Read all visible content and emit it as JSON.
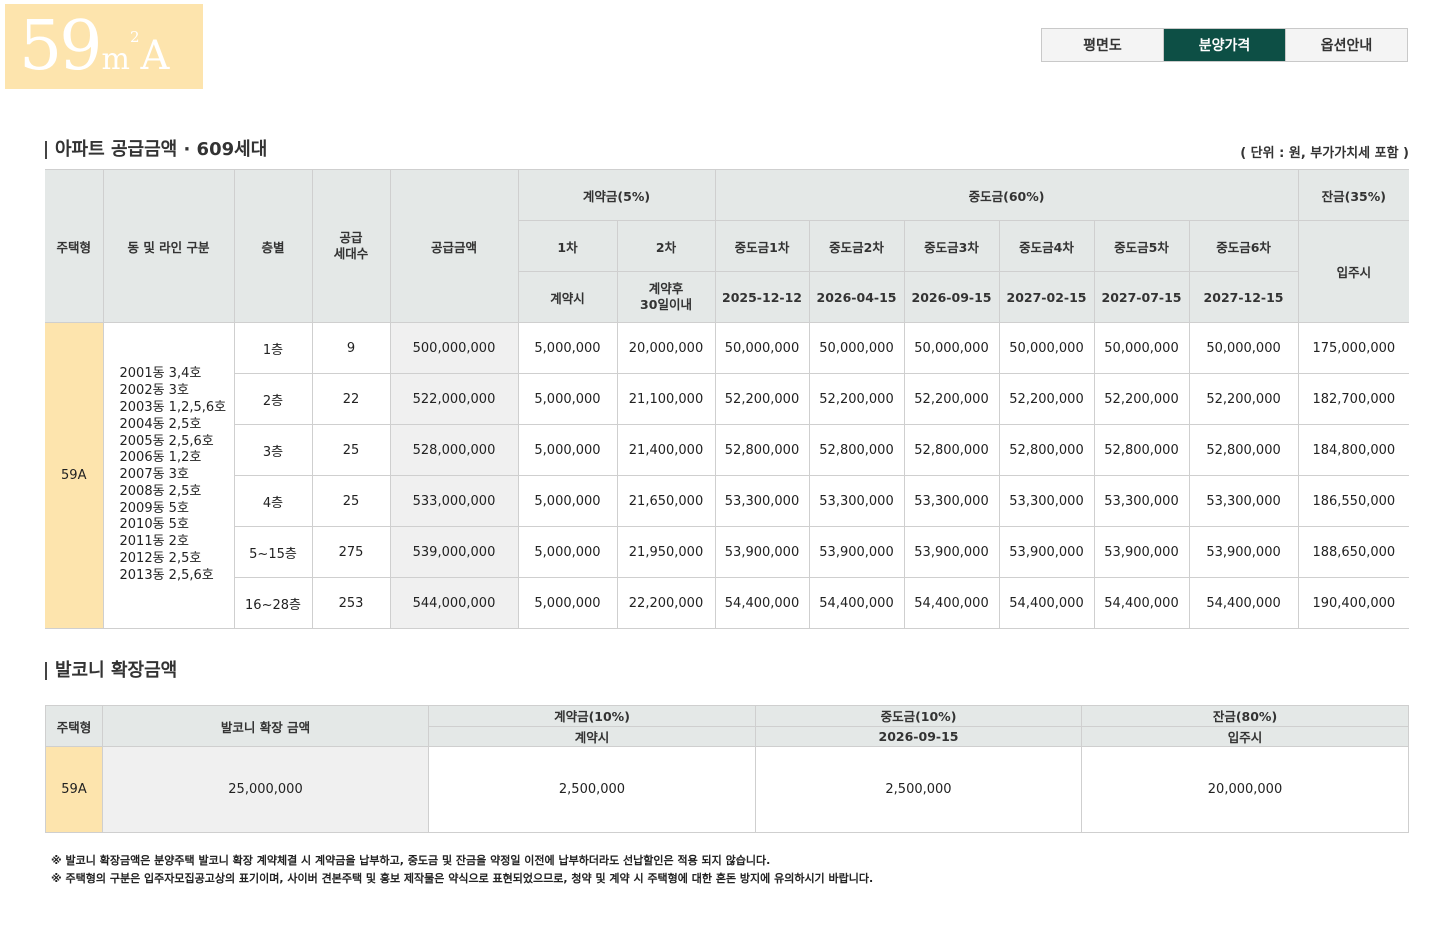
{
  "badge": {
    "number": "59",
    "unit": "m",
    "sup": "2",
    "letter": "A"
  },
  "tabs": [
    {
      "label": "평면도",
      "active": false
    },
    {
      "label": "분양가격",
      "active": true
    },
    {
      "label": "옵션안내",
      "active": false
    }
  ],
  "apt": {
    "title": "아파트 공급금액 · 609세대",
    "unit_note": "( 단위 : 원, 부가가치세 포함 )",
    "headers": {
      "type": "주택형",
      "dong": "동 및 라인 구분",
      "floor": "층별",
      "units": "공급\n세대수",
      "price": "공급금액",
      "contract": "계약금(5%)",
      "middle": "중도금(60%)",
      "balance": "잔금(35%)",
      "c1": "1차",
      "c2": "2차",
      "c1_sub": "계약시",
      "c2_sub": "계약후\n30일이내",
      "m1": "중도금1차",
      "m2": "중도금2차",
      "m3": "중도금3차",
      "m4": "중도금4차",
      "m5": "중도금5차",
      "m6": "중도금6차",
      "d1": "2025-12-12",
      "d2": "2026-04-15",
      "d3": "2026-09-15",
      "d4": "2027-02-15",
      "d5": "2027-07-15",
      "d6": "2027-12-15",
      "movein": "입주시"
    },
    "type_name": "59A",
    "dong_lines": "2001동 3,4호\n2002동 3호\n2003동 1,2,5,6호\n2004동 2,5호\n2005동 2,5,6호\n2006동 1,2호\n2007동 3호\n2008동 2,5호\n2009동 5호\n2010동 5호\n2011동 2호\n2012동 2,5호\n2013동 2,5,6호",
    "rows": [
      {
        "floor": "1층",
        "units": "9",
        "price": "500,000,000",
        "c1": "5,000,000",
        "c2": "20,000,000",
        "mid": "50,000,000",
        "bal": "175,000,000"
      },
      {
        "floor": "2층",
        "units": "22",
        "price": "522,000,000",
        "c1": "5,000,000",
        "c2": "21,100,000",
        "mid": "52,200,000",
        "bal": "182,700,000"
      },
      {
        "floor": "3층",
        "units": "25",
        "price": "528,000,000",
        "c1": "5,000,000",
        "c2": "21,400,000",
        "mid": "52,800,000",
        "bal": "184,800,000"
      },
      {
        "floor": "4층",
        "units": "25",
        "price": "533,000,000",
        "c1": "5,000,000",
        "c2": "21,650,000",
        "mid": "53,300,000",
        "bal": "186,550,000"
      },
      {
        "floor": "5~15층",
        "units": "275",
        "price": "539,000,000",
        "c1": "5,000,000",
        "c2": "21,950,000",
        "mid": "53,900,000",
        "bal": "188,650,000"
      },
      {
        "floor": "16~28층",
        "units": "253",
        "price": "544,000,000",
        "c1": "5,000,000",
        "c2": "22,200,000",
        "mid": "54,400,000",
        "bal": "190,400,000"
      }
    ]
  },
  "balcony": {
    "title": "발코니 확장금액",
    "headers": {
      "type": "주택형",
      "amount": "발코니 확장 금액",
      "contract": "계약금(10%)",
      "contract_sub": "계약시",
      "middle": "중도금(10%)",
      "middle_sub": "2026-09-15",
      "balance": "잔금(80%)",
      "balance_sub": "입주시"
    },
    "row": {
      "type": "59A",
      "amount": "25,000,000",
      "contract": "2,500,000",
      "middle": "2,500,000",
      "balance": "20,000,000"
    }
  },
  "notes": [
    "※ 발코니 확장금액은 분양주택 발코니 확장 계약체결 시 계약금을 납부하고, 중도금 및 잔금을 약정일 이전에 납부하더라도 선납할인은 적용 되지 않습니다.",
    "※ 주택형의 구분은 입주자모집공고상의 표기이며, 사이버 견본주택 및 홍보 제작물은 약식으로 표현되었으므로, 청약 및 계약 시 주택형에 대한 혼돈 방지에 유의하시기 바랍니다."
  ]
}
